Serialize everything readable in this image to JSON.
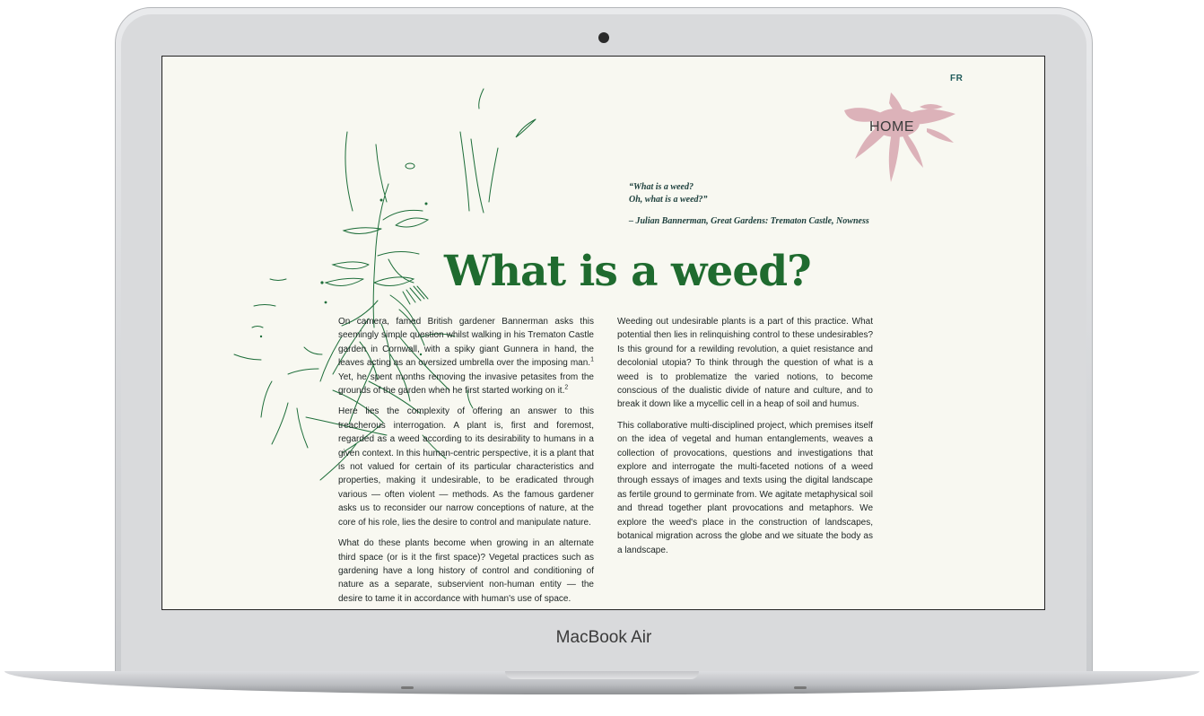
{
  "device": {
    "brand_label": "MacBook Air"
  },
  "page": {
    "lang_toggle": "FR",
    "home_label": "HOME",
    "quote": {
      "line1": "“What is a weed?",
      "line2": "Oh, what is a weed?”",
      "attribution": "– Julian Bannerman, Great Gardens: Trematon Castle, Nowness"
    },
    "title": "What is a weed?",
    "left_column": {
      "p1": "On camera, famed British gardener Bannerman asks this seemingly simple question whilst walking in his Trematon Castle garden in Cornwall, with a spiky giant Gunnera in hand, the leaves acting as an oversized umbrella over the imposing man.",
      "p1_sup1": "1",
      "p1_cont": " Yet, he spent months removing the invasive petasites from the grounds of the garden when he first started working on it.",
      "p1_sup2": "2",
      "p2": "Here lies the complexity of offering an answer to this treacherous interrogation. A plant is, first and foremost, regarded as a weed according to its desirability to humans in a given context. In this human-centric perspective, it is a plant that is not valued for certain of its particular characteristics and properties, making it undesirable, to be eradicated through various — often violent — methods. As the famous gardener asks us to reconsider our narrow conceptions of nature, at the core of his role, lies the desire to control and manipulate nature.",
      "p3": "What do these plants become when growing in an alternate third space (or is it the first space)? Vegetal practices such as gardening have a long history of control and conditioning of nature as a separate, subservient non-human entity — the desire to tame it in accordance with human's use of space."
    },
    "right_column": {
      "p1": "Weeding out undesirable plants is a part of this practice. What potential then lies in relinquishing control to these undesirables? Is this ground for a rewilding revolution, a quiet resistance and decolonial utopia? To think through the question of what is a weed is to problematize the varied notions, to become conscious of the dualistic divide of nature and culture, and to break it down like a mycellic cell in a heap of soil and humus.",
      "p2": "This collaborative multi-disciplined project, which premises itself on the idea of vegetal and human entanglements, weaves a collection of provocations, questions and investigations that explore and interrogate the multi-faceted notions of a weed through essays of images and texts using the digital landscape as fertile ground to germinate from. We agitate metaphysical soil and thread together plant provocations and metaphors. We explore the weed's place in the construction of landscapes, botanical migration across the globe and we situate the body as a landscape."
    },
    "colors": {
      "title_green": "#1f6b2f",
      "sketch_green": "#1e6e3a",
      "flower_pink": "#d8a6b0",
      "background": "#f8f8f1"
    },
    "icons": [
      "weed-sketch-illustration",
      "flower-icon"
    ]
  }
}
